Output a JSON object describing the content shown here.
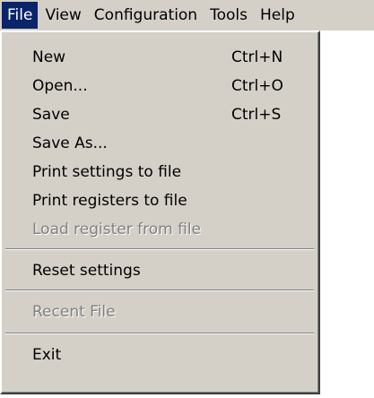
{
  "menubar": {
    "items": [
      {
        "label": "File"
      },
      {
        "label": "View"
      },
      {
        "label": "Configuration"
      },
      {
        "label": "Tools"
      },
      {
        "label": "Help"
      }
    ]
  },
  "file_menu": {
    "new": {
      "label": "New",
      "shortcut": "Ctrl+N"
    },
    "open": {
      "label": "Open...",
      "shortcut": "Ctrl+O"
    },
    "save": {
      "label": "Save",
      "shortcut": "Ctrl+S"
    },
    "save_as": {
      "label": "Save As..."
    },
    "print_settings": {
      "label": "Print settings to file"
    },
    "print_registers": {
      "label": "Print registers to file"
    },
    "load_register": {
      "label": "Load register from file",
      "disabled": true
    },
    "reset_settings": {
      "label": "Reset settings"
    },
    "recent_file": {
      "label": "Recent File",
      "disabled": true
    },
    "exit": {
      "label": "Exit"
    }
  },
  "colors": {
    "face": "#d4d0c8",
    "highlight": "#0a246a",
    "disabled_text": "#808080"
  }
}
